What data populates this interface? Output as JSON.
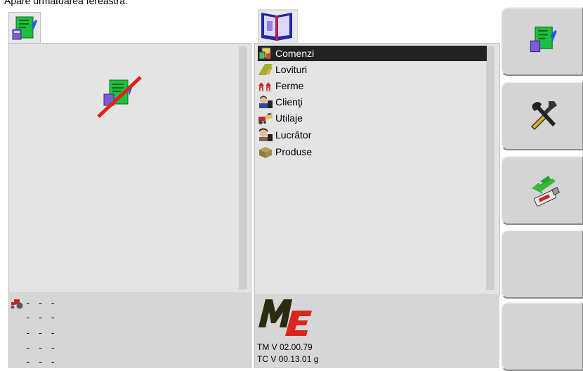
{
  "caption": "Apare următoarea fereastră:",
  "menu": {
    "items": [
      {
        "label": "Comenzi",
        "selected": true
      },
      {
        "label": "Lovituri",
        "selected": false
      },
      {
        "label": "Ferme",
        "selected": false
      },
      {
        "label": "Clienţi",
        "selected": false
      },
      {
        "label": "Utilaje",
        "selected": false
      },
      {
        "label": "Lucrător",
        "selected": false
      },
      {
        "label": "Produse",
        "selected": false
      }
    ]
  },
  "status": {
    "rows": [
      "- - -",
      "- - -",
      "- - -",
      "- - -",
      "- - -"
    ]
  },
  "version": {
    "tm": "TM V 02.00.79",
    "tc": "TC V 00.13.01 g"
  },
  "softkeys": [
    {
      "icon": "job-data-icon"
    },
    {
      "icon": "settings-tools-icon"
    },
    {
      "icon": "usb-export-icon"
    },
    {
      "icon": ""
    },
    {
      "icon": ""
    }
  ],
  "colors": {
    "selection_bg": "#222222",
    "panel_bg": "#e4e4e4",
    "button_bg": "#d4d4d4",
    "logo_dark": "#2b2b10",
    "logo_red": "#d9261c"
  }
}
